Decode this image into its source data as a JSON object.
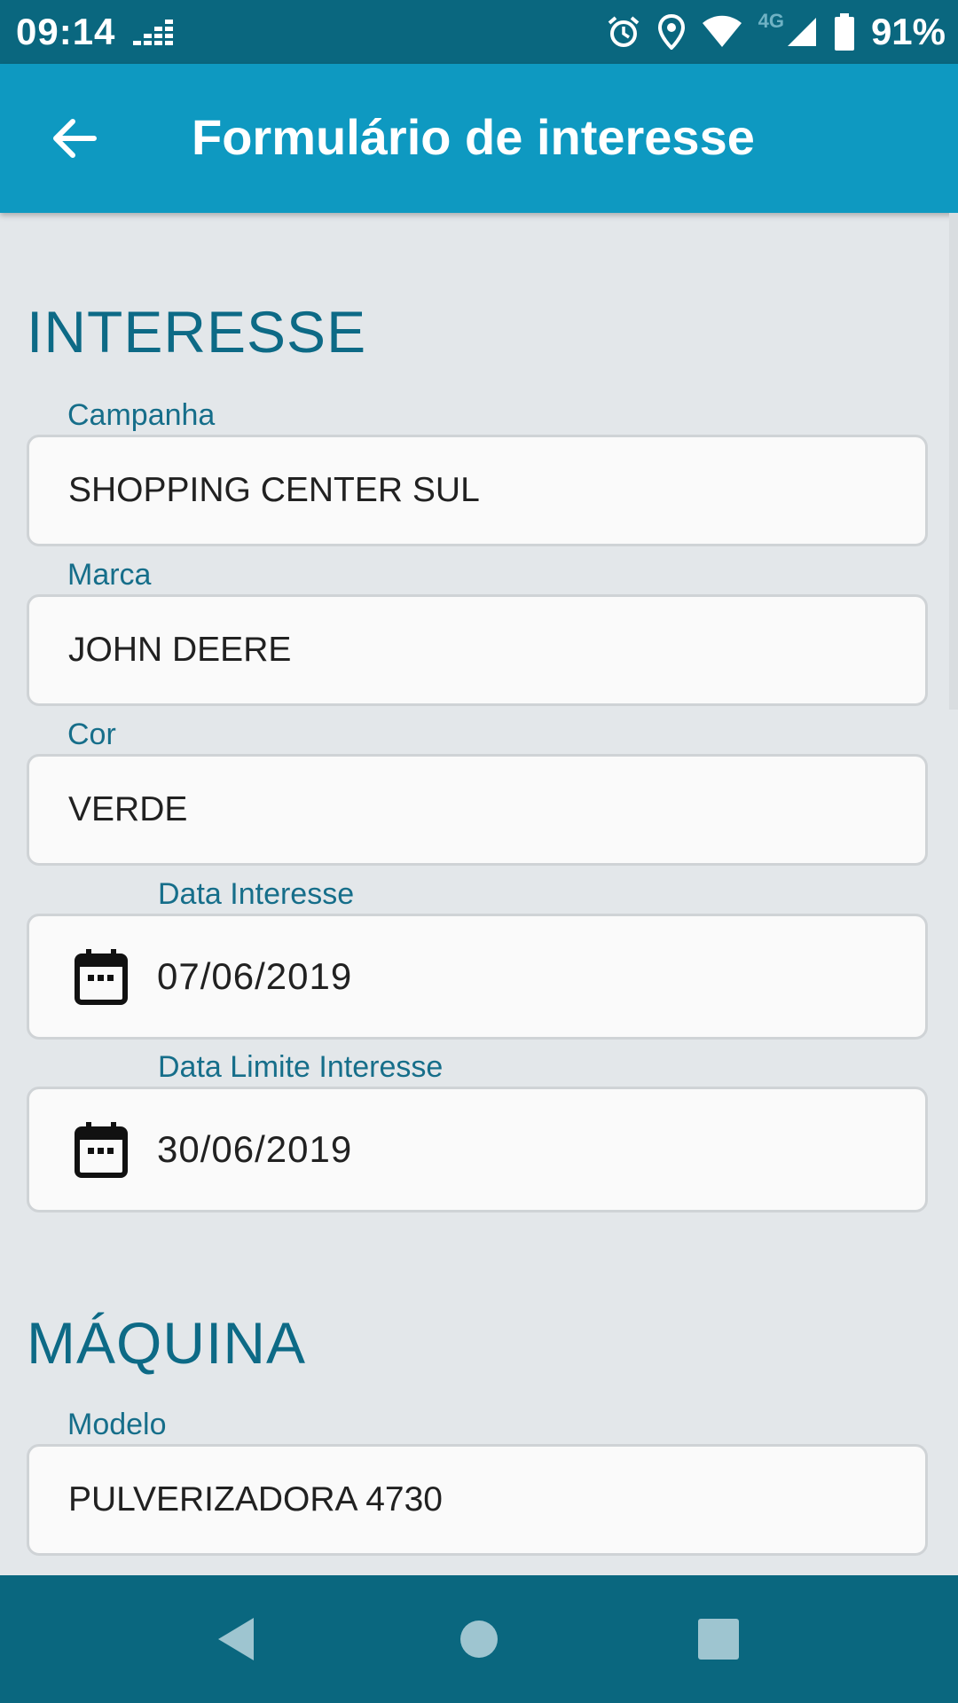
{
  "status_bar": {
    "time": "09:14",
    "network_type": "4G",
    "battery_percent": "91%",
    "icons": [
      "deezer-icon",
      "alarm-icon",
      "location-icon",
      "wifi-icon",
      "cell-signal-icon",
      "battery-icon"
    ]
  },
  "app_bar": {
    "title": "Formulário de interesse",
    "back_icon": "arrow-back-icon"
  },
  "sections": {
    "interesse": {
      "title": "INTERESSE",
      "campanha": {
        "label": "Campanha",
        "value": "SHOPPING CENTER SUL"
      },
      "marca": {
        "label": "Marca",
        "value": "JOHN DEERE"
      },
      "cor": {
        "label": "Cor",
        "value": "VERDE"
      },
      "data_interesse": {
        "label": "Data Interesse",
        "value": "07/06/2019",
        "icon": "calendar-icon"
      },
      "data_limite": {
        "label": "Data Limite Interesse",
        "value": "30/06/2019",
        "icon": "calendar-icon"
      }
    },
    "maquina": {
      "title": "MÁQUINA",
      "modelo": {
        "label": "Modelo",
        "value": "PULVERIZADORA 4730"
      }
    }
  },
  "nav_bar": {
    "icons": [
      "back-triangle-icon",
      "home-circle-icon",
      "recents-square-icon"
    ]
  },
  "colors": {
    "status_bar": "#0a677f",
    "app_bar": "#0e99c1",
    "accent_text": "#0d6a86",
    "background": "#e3e7ea"
  }
}
